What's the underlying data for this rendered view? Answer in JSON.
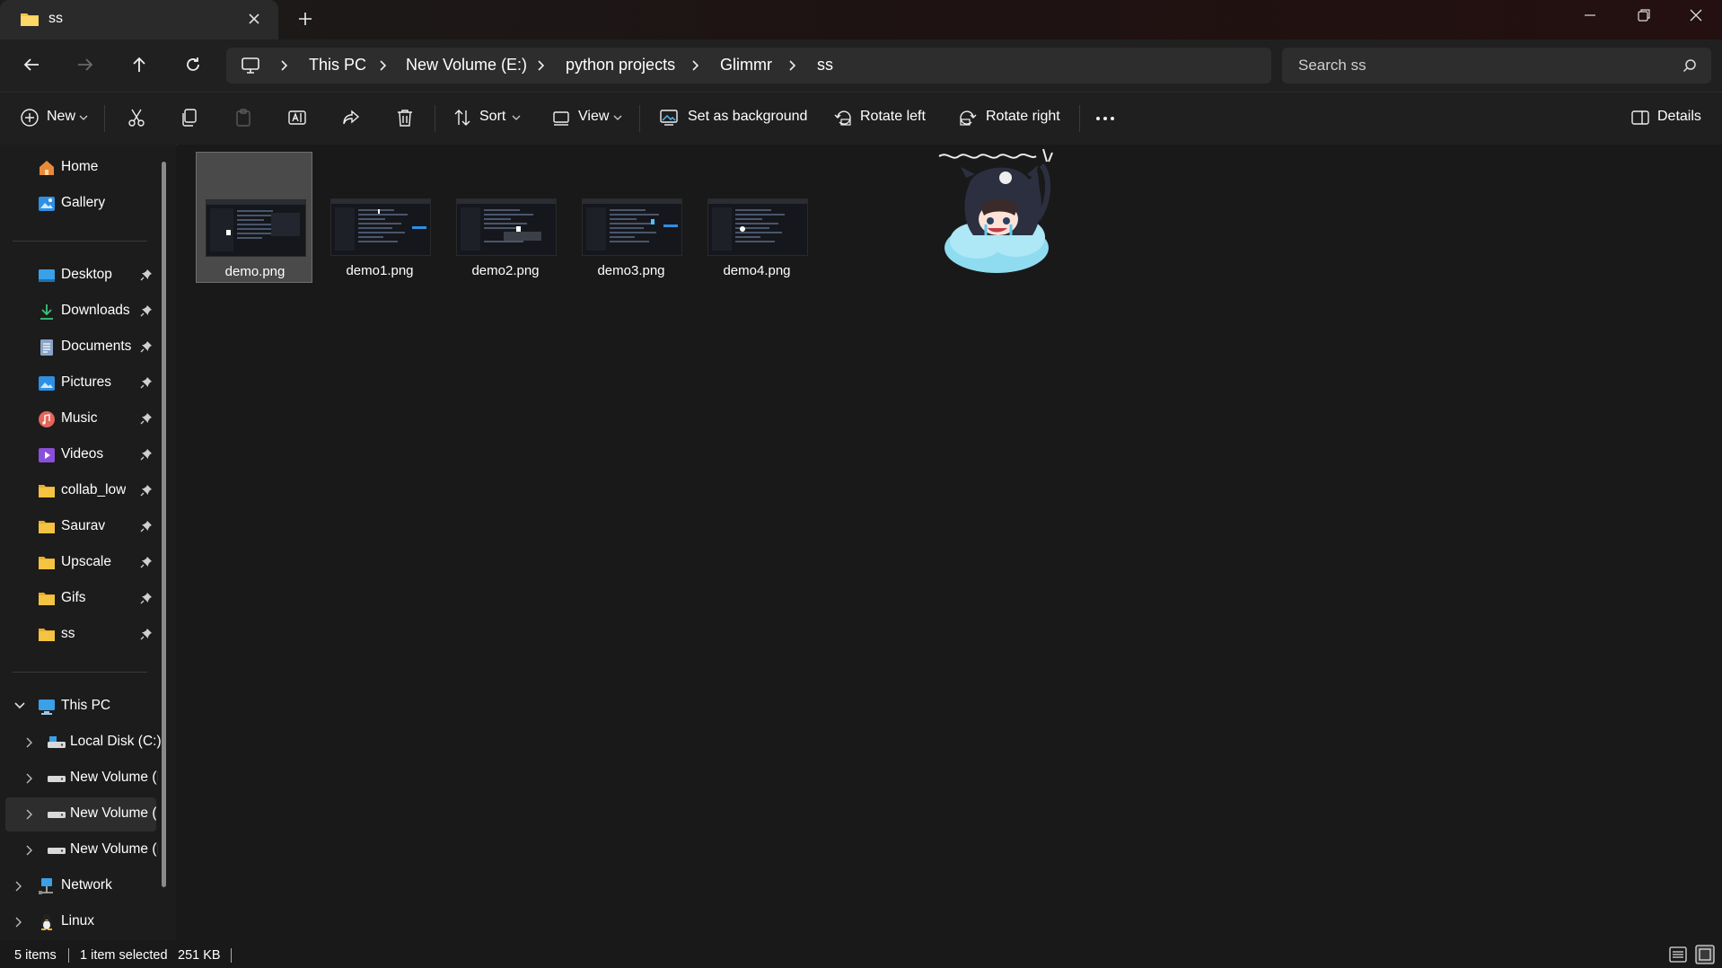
{
  "window": {
    "tab_title": "ss",
    "icons": [
      "folder-icon",
      "close-icon",
      "plus-icon",
      "minimize-icon",
      "restore-icon",
      "close-window-icon"
    ]
  },
  "address": {
    "crumbs": [
      "This PC",
      "New Volume (E:)",
      "python projects",
      "Glimmr",
      "ss"
    ],
    "search_placeholder": "Search ss"
  },
  "toolbar": {
    "new_label": "New",
    "sort_label": "Sort",
    "view_label": "View",
    "set_background_label": "Set as background",
    "rotate_left_label": "Rotate left",
    "rotate_right_label": "Rotate right",
    "details_label": "Details",
    "icons": [
      "plus-circle-icon",
      "cut-icon",
      "copy-icon",
      "paste-icon",
      "rename-icon",
      "share-icon",
      "delete-icon",
      "more-icon"
    ]
  },
  "sidebar": {
    "home": "Home",
    "gallery": "Gallery",
    "pinned": [
      "Desktop",
      "Downloads",
      "Documents",
      "Pictures",
      "Music",
      "Videos",
      "collab_low",
      "Saurav",
      "Upscale",
      "Gifs",
      "ss"
    ],
    "this_pc": "This PC",
    "drives": [
      "Local Disk (C:)",
      "New Volume (I",
      "New Volume (I",
      "New Volume (I"
    ],
    "network": "Network",
    "linux": "Linux"
  },
  "files": [
    {
      "name": "demo.png",
      "selected": true
    },
    {
      "name": "demo1.png",
      "selected": false
    },
    {
      "name": "demo2.png",
      "selected": false
    },
    {
      "name": "demo3.png",
      "selected": false
    },
    {
      "name": "demo4.png",
      "selected": false
    }
  ],
  "status": {
    "items": "5 items",
    "selected": "1 item selected",
    "size": "251 KB"
  },
  "colors": {
    "background": "#191919",
    "selection": "#4a4a4a",
    "folder": "#f5c342",
    "accent": "#4cc2ff"
  }
}
